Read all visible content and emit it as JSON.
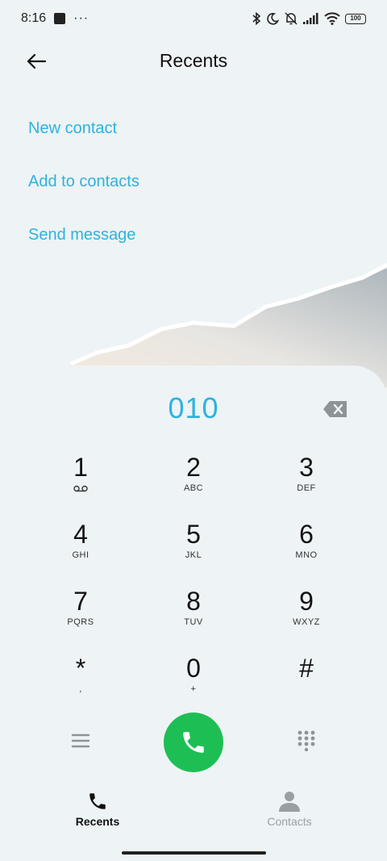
{
  "status_bar": {
    "time": "8:16",
    "more": "···",
    "battery": "100"
  },
  "header": {
    "title": "Recents"
  },
  "actions": {
    "new_contact": "New contact",
    "add_to_contacts": "Add to contacts",
    "send_message": "Send message"
  },
  "dialer": {
    "number": "010",
    "keys": [
      {
        "digit": "1",
        "sub": "voicemail-icon"
      },
      {
        "digit": "2",
        "sub": "ABC"
      },
      {
        "digit": "3",
        "sub": "DEF"
      },
      {
        "digit": "4",
        "sub": "GHI"
      },
      {
        "digit": "5",
        "sub": "JKL"
      },
      {
        "digit": "6",
        "sub": "MNO"
      },
      {
        "digit": "7",
        "sub": "PQRS"
      },
      {
        "digit": "8",
        "sub": "TUV"
      },
      {
        "digit": "9",
        "sub": "WXYZ"
      },
      {
        "digit": "*",
        "sub": ","
      },
      {
        "digit": "0",
        "sub": "+"
      },
      {
        "digit": "#",
        "sub": ""
      }
    ]
  },
  "bottom_nav": {
    "recents": "Recents",
    "contacts": "Contacts"
  },
  "colors": {
    "accent": "#2cb3de",
    "call": "#1dbf54",
    "background": "#eef3f5"
  }
}
